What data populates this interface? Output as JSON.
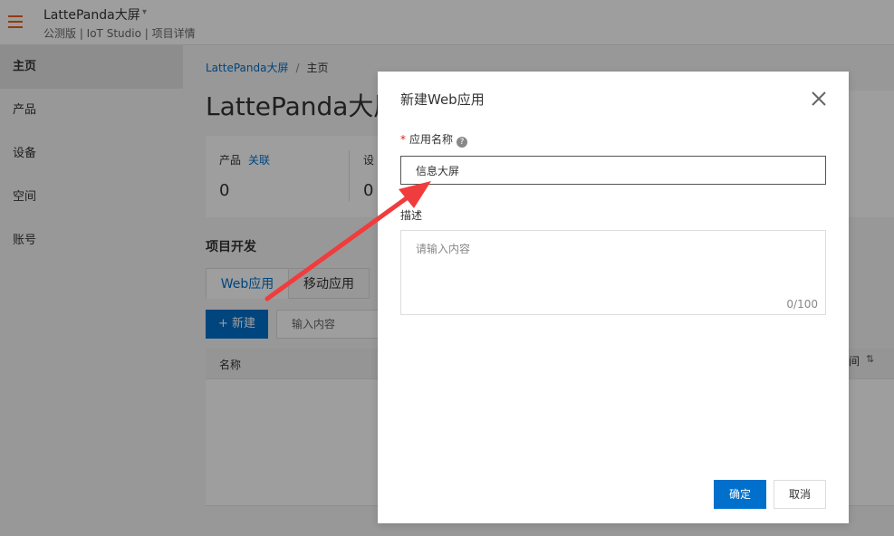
{
  "header": {
    "app_title": "LattePanda大屏",
    "caret": "▾",
    "subtitle": "公测版 | IoT Studio | 项目详情"
  },
  "sidebar": {
    "items": [
      {
        "label": "主页"
      },
      {
        "label": "产品"
      },
      {
        "label": "设备"
      },
      {
        "label": "空间"
      },
      {
        "label": "账号"
      }
    ]
  },
  "main": {
    "breadcrumb": {
      "link": "LattePanda大屏",
      "separator": "/",
      "current": "主页"
    },
    "page_title": "LattePanda大屏",
    "stats": {
      "product_label": "产品",
      "product_link": "关联",
      "product_count": "0",
      "device_label": "设",
      "device_count": "0"
    },
    "section_title": "项目开发",
    "tabs": [
      {
        "label": "Web应用"
      },
      {
        "label": "移动应用"
      }
    ],
    "new_button": "+ 新建",
    "search_placeholder": "输入内容",
    "table_header_name": "名称",
    "table_header_right": "间",
    "sort_icon": "⇅"
  },
  "modal": {
    "title": "新建Web应用",
    "name_label": "应用名称",
    "required_mark": "*",
    "help_icon": "?",
    "name_value": "信息大屏",
    "desc_label": "描述",
    "desc_placeholder": "请输入内容",
    "counter": "0/100",
    "ok_label": "确定",
    "cancel_label": "取消"
  },
  "colors": {
    "accent": "#0070cc",
    "menu_icon": "#e8601f",
    "annotation_arrow": "#f03c3c"
  }
}
